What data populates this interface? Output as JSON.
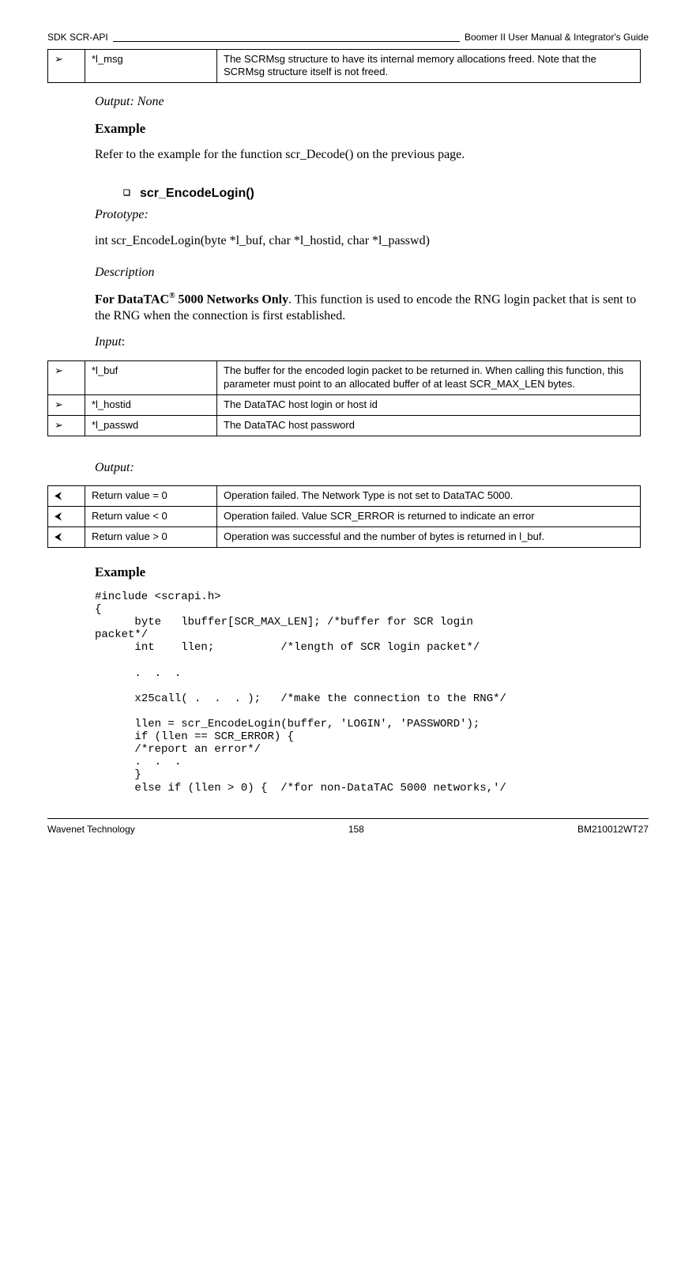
{
  "header": {
    "left": "SDK SCR-API",
    "right": "Boomer II User Manual & Integrator's Guide"
  },
  "footer": {
    "left": "Wavenet Technology",
    "center": "158",
    "right": "BM210012WT27"
  },
  "tables": {
    "msg": {
      "rows": [
        {
          "sym": "➢",
          "name": "*l_msg",
          "desc": "The SCRMsg structure to have its internal memory allocations freed. Note that the SCRMsg structure itself is not freed."
        }
      ]
    },
    "input": {
      "rows": [
        {
          "sym": "➢",
          "name": "*l_buf",
          "desc": "The buffer for the encoded login packet to be returned in. When calling this function, this parameter must point to an allocated buffer of at least SCR_MAX_LEN bytes."
        },
        {
          "sym": "➢",
          "name": "*l_hostid",
          "desc": "The DataTAC host login or host id"
        },
        {
          "sym": "➢",
          "name": "*l_passwd",
          "desc": "The DataTAC host password"
        }
      ]
    },
    "output": {
      "rows": [
        {
          "sym": "⮜",
          "name": "Return value = 0",
          "desc": "Operation failed. The Network Type is not set to DataTAC 5000."
        },
        {
          "sym": "⮜",
          "name": "Return value  < 0",
          "desc": "Operation failed. Value SCR_ERROR is returned to indicate an error"
        },
        {
          "sym": "⮜",
          "name": "Return value  > 0",
          "desc": "Operation was successful and the number of bytes is returned in l_buf."
        }
      ]
    }
  },
  "text": {
    "output_none": "Output: None",
    "example_h": "Example",
    "example_ref": "Refer to the example for the function scr_Decode() on the previous page.",
    "func_heading": "scr_EncodeLogin()",
    "prototype_label": "Prototype:",
    "prototype": "int scr_EncodeLogin(byte *l_buf, char *l_hostid, char *l_passwd)",
    "description_label": "Description",
    "desc_prefix_bold": "For DataTAC",
    "desc_reg": "®",
    "desc_suffix_bold": " 5000 Networks Only",
    "desc_rest": ". This function is used to encode the RNG login packet that is sent to the RNG when the connection is first established.",
    "input_label": "Input",
    "output_label": "Output:",
    "example2_h": "Example",
    "code": "#include <scrapi.h>\n{\n      byte   lbuffer[SCR_MAX_LEN]; /*buffer for SCR login\npacket*/\n      int    llen;          /*length of SCR login packet*/\n\n      .  .  .\n\n      x25call( .  .  . );   /*make the connection to the RNG*/\n\n      llen = scr_EncodeLogin(buffer, 'LOGIN', 'PASSWORD');\n      if (llen == SCR_ERROR) {\n      /*report an error*/\n      .  .  .\n      }\n      else if (llen > 0) {  /*for non-DataTAC 5000 networks,'/"
  }
}
